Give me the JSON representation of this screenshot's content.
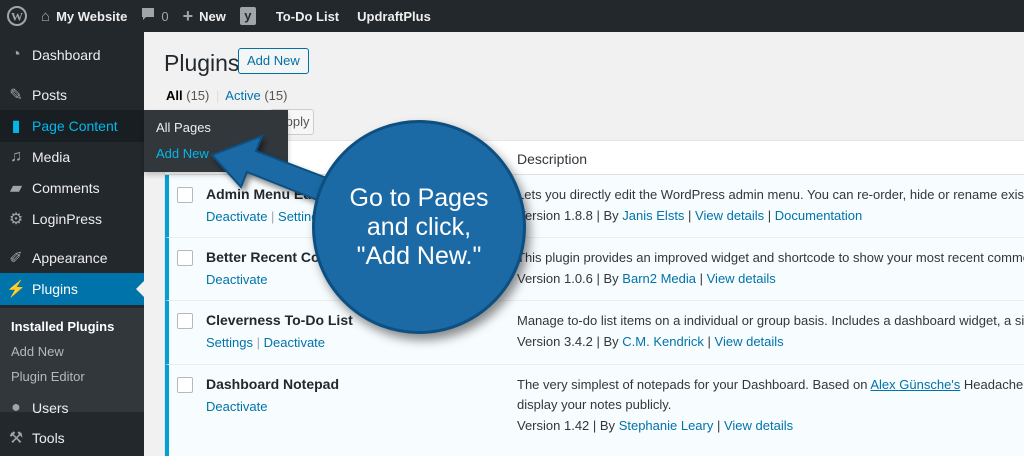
{
  "adminbar": {
    "site_name": "My Website",
    "comments_count": "0",
    "new_label": "New",
    "todo_label": "To-Do List",
    "updraft_label": "UpdraftPlus"
  },
  "sidebar": {
    "items": [
      {
        "label": "Dashboard",
        "icon": "dashboard-icon"
      },
      {
        "label": "Posts",
        "icon": "pin-icon"
      },
      {
        "label": "Page Content",
        "icon": "pages-icon"
      },
      {
        "label": "Media",
        "icon": "media-icon"
      },
      {
        "label": "Comments",
        "icon": "comments-icon"
      },
      {
        "label": "LoginPress",
        "icon": "gear-icon"
      },
      {
        "label": "Appearance",
        "icon": "brush-icon"
      },
      {
        "label": "Plugins",
        "icon": "plugin-icon"
      },
      {
        "label": "Users",
        "icon": "users-icon"
      },
      {
        "label": "Tools",
        "icon": "wrench-icon"
      }
    ],
    "submenu": [
      "Installed Plugins",
      "Add New",
      "Plugin Editor"
    ]
  },
  "flyout": [
    "All Pages",
    "Add New"
  ],
  "main": {
    "title": "Plugins",
    "add_new_label": "Add New",
    "filter_all": "All",
    "filter_all_count": "(15)",
    "filter_sep": "|",
    "filter_active": "Active",
    "filter_active_count": "(15)",
    "apply_label": "Apply",
    "col_description": "Description"
  },
  "plugins": [
    {
      "name": "Admin Menu Editor",
      "actions": [
        "Deactivate",
        "Settings"
      ],
      "desc": "Lets you directly edit the WordPress admin menu. You can re-order, hide or rename existing menus",
      "version": "Version 1.8.8",
      "by": "By",
      "author": "Janis Elsts",
      "links": [
        "View details",
        "Documentation"
      ]
    },
    {
      "name": "Better Recent Comments",
      "actions": [
        "Deactivate"
      ],
      "desc": "This plugin provides an improved widget and shortcode to show your most recent comments. If u",
      "version": "Version 1.0.6",
      "by": "By",
      "author": "Barn2 Media",
      "links": [
        "View details"
      ]
    },
    {
      "name": "Cleverness To-Do List",
      "actions": [
        "Settings",
        "Deactivate"
      ],
      "desc": "Manage to-do list items on a individual or group basis. Includes a dashboard widget, a sidebar wid",
      "version": "Version 3.4.2",
      "by": "By",
      "author": "C.M. Kendrick",
      "links": [
        "View details"
      ]
    },
    {
      "name": "Dashboard Notepad",
      "actions": [
        "Deactivate"
      ],
      "desc_pre": "The very simplest of notepads for your Dashboard. Based on ",
      "desc_link": "Alex Günsche's",
      "desc_post": " Headache With Pictur",
      "desc_line2": "display your notes publicly.",
      "version": "Version 1.42",
      "by": "By",
      "author": "Stephanie Leary",
      "links": [
        "View details"
      ]
    }
  ],
  "callout": {
    "line1": "Go to Pages",
    "line2": "and click,",
    "line3": "\"Add New.\""
  },
  "colors": {
    "sidebar_bg": "#23282d",
    "accent": "#0073aa",
    "bubble": "#1b6aa5"
  }
}
